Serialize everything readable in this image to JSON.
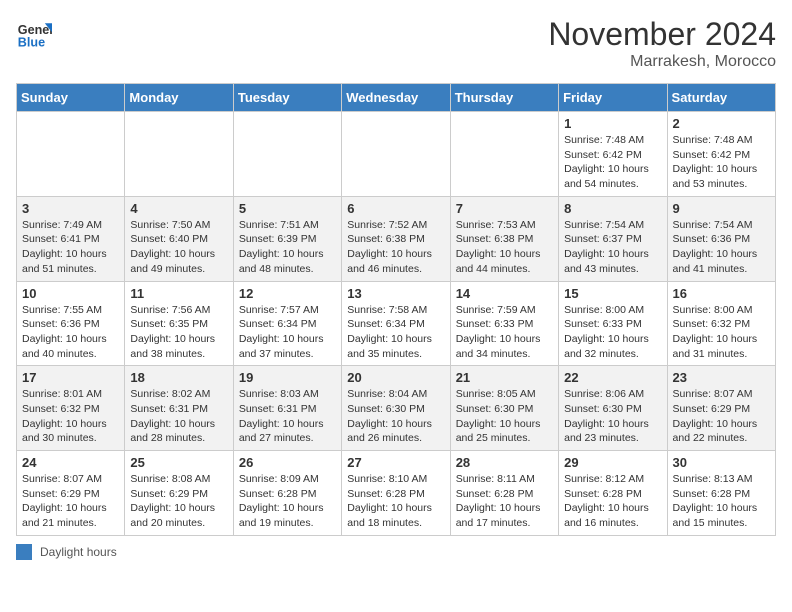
{
  "header": {
    "logo_general": "General",
    "logo_blue": "Blue",
    "month_title": "November 2024",
    "location": "Marrakesh, Morocco"
  },
  "days_of_week": [
    "Sunday",
    "Monday",
    "Tuesday",
    "Wednesday",
    "Thursday",
    "Friday",
    "Saturday"
  ],
  "legend": {
    "label": "Daylight hours"
  },
  "weeks": [
    {
      "days": [
        null,
        null,
        null,
        null,
        null,
        {
          "num": "1",
          "sunrise": "Sunrise: 7:48 AM",
          "sunset": "Sunset: 6:42 PM",
          "daylight": "Daylight: 10 hours and 54 minutes."
        },
        {
          "num": "2",
          "sunrise": "Sunrise: 7:48 AM",
          "sunset": "Sunset: 6:42 PM",
          "daylight": "Daylight: 10 hours and 53 minutes."
        }
      ]
    },
    {
      "days": [
        {
          "num": "3",
          "sunrise": "Sunrise: 7:49 AM",
          "sunset": "Sunset: 6:41 PM",
          "daylight": "Daylight: 10 hours and 51 minutes."
        },
        {
          "num": "4",
          "sunrise": "Sunrise: 7:50 AM",
          "sunset": "Sunset: 6:40 PM",
          "daylight": "Daylight: 10 hours and 49 minutes."
        },
        {
          "num": "5",
          "sunrise": "Sunrise: 7:51 AM",
          "sunset": "Sunset: 6:39 PM",
          "daylight": "Daylight: 10 hours and 48 minutes."
        },
        {
          "num": "6",
          "sunrise": "Sunrise: 7:52 AM",
          "sunset": "Sunset: 6:38 PM",
          "daylight": "Daylight: 10 hours and 46 minutes."
        },
        {
          "num": "7",
          "sunrise": "Sunrise: 7:53 AM",
          "sunset": "Sunset: 6:38 PM",
          "daylight": "Daylight: 10 hours and 44 minutes."
        },
        {
          "num": "8",
          "sunrise": "Sunrise: 7:54 AM",
          "sunset": "Sunset: 6:37 PM",
          "daylight": "Daylight: 10 hours and 43 minutes."
        },
        {
          "num": "9",
          "sunrise": "Sunrise: 7:54 AM",
          "sunset": "Sunset: 6:36 PM",
          "daylight": "Daylight: 10 hours and 41 minutes."
        }
      ]
    },
    {
      "days": [
        {
          "num": "10",
          "sunrise": "Sunrise: 7:55 AM",
          "sunset": "Sunset: 6:36 PM",
          "daylight": "Daylight: 10 hours and 40 minutes."
        },
        {
          "num": "11",
          "sunrise": "Sunrise: 7:56 AM",
          "sunset": "Sunset: 6:35 PM",
          "daylight": "Daylight: 10 hours and 38 minutes."
        },
        {
          "num": "12",
          "sunrise": "Sunrise: 7:57 AM",
          "sunset": "Sunset: 6:34 PM",
          "daylight": "Daylight: 10 hours and 37 minutes."
        },
        {
          "num": "13",
          "sunrise": "Sunrise: 7:58 AM",
          "sunset": "Sunset: 6:34 PM",
          "daylight": "Daylight: 10 hours and 35 minutes."
        },
        {
          "num": "14",
          "sunrise": "Sunrise: 7:59 AM",
          "sunset": "Sunset: 6:33 PM",
          "daylight": "Daylight: 10 hours and 34 minutes."
        },
        {
          "num": "15",
          "sunrise": "Sunrise: 8:00 AM",
          "sunset": "Sunset: 6:33 PM",
          "daylight": "Daylight: 10 hours and 32 minutes."
        },
        {
          "num": "16",
          "sunrise": "Sunrise: 8:00 AM",
          "sunset": "Sunset: 6:32 PM",
          "daylight": "Daylight: 10 hours and 31 minutes."
        }
      ]
    },
    {
      "days": [
        {
          "num": "17",
          "sunrise": "Sunrise: 8:01 AM",
          "sunset": "Sunset: 6:32 PM",
          "daylight": "Daylight: 10 hours and 30 minutes."
        },
        {
          "num": "18",
          "sunrise": "Sunrise: 8:02 AM",
          "sunset": "Sunset: 6:31 PM",
          "daylight": "Daylight: 10 hours and 28 minutes."
        },
        {
          "num": "19",
          "sunrise": "Sunrise: 8:03 AM",
          "sunset": "Sunset: 6:31 PM",
          "daylight": "Daylight: 10 hours and 27 minutes."
        },
        {
          "num": "20",
          "sunrise": "Sunrise: 8:04 AM",
          "sunset": "Sunset: 6:30 PM",
          "daylight": "Daylight: 10 hours and 26 minutes."
        },
        {
          "num": "21",
          "sunrise": "Sunrise: 8:05 AM",
          "sunset": "Sunset: 6:30 PM",
          "daylight": "Daylight: 10 hours and 25 minutes."
        },
        {
          "num": "22",
          "sunrise": "Sunrise: 8:06 AM",
          "sunset": "Sunset: 6:30 PM",
          "daylight": "Daylight: 10 hours and 23 minutes."
        },
        {
          "num": "23",
          "sunrise": "Sunrise: 8:07 AM",
          "sunset": "Sunset: 6:29 PM",
          "daylight": "Daylight: 10 hours and 22 minutes."
        }
      ]
    },
    {
      "days": [
        {
          "num": "24",
          "sunrise": "Sunrise: 8:07 AM",
          "sunset": "Sunset: 6:29 PM",
          "daylight": "Daylight: 10 hours and 21 minutes."
        },
        {
          "num": "25",
          "sunrise": "Sunrise: 8:08 AM",
          "sunset": "Sunset: 6:29 PM",
          "daylight": "Daylight: 10 hours and 20 minutes."
        },
        {
          "num": "26",
          "sunrise": "Sunrise: 8:09 AM",
          "sunset": "Sunset: 6:28 PM",
          "daylight": "Daylight: 10 hours and 19 minutes."
        },
        {
          "num": "27",
          "sunrise": "Sunrise: 8:10 AM",
          "sunset": "Sunset: 6:28 PM",
          "daylight": "Daylight: 10 hours and 18 minutes."
        },
        {
          "num": "28",
          "sunrise": "Sunrise: 8:11 AM",
          "sunset": "Sunset: 6:28 PM",
          "daylight": "Daylight: 10 hours and 17 minutes."
        },
        {
          "num": "29",
          "sunrise": "Sunrise: 8:12 AM",
          "sunset": "Sunset: 6:28 PM",
          "daylight": "Daylight: 10 hours and 16 minutes."
        },
        {
          "num": "30",
          "sunrise": "Sunrise: 8:13 AM",
          "sunset": "Sunset: 6:28 PM",
          "daylight": "Daylight: 10 hours and 15 minutes."
        }
      ]
    }
  ]
}
